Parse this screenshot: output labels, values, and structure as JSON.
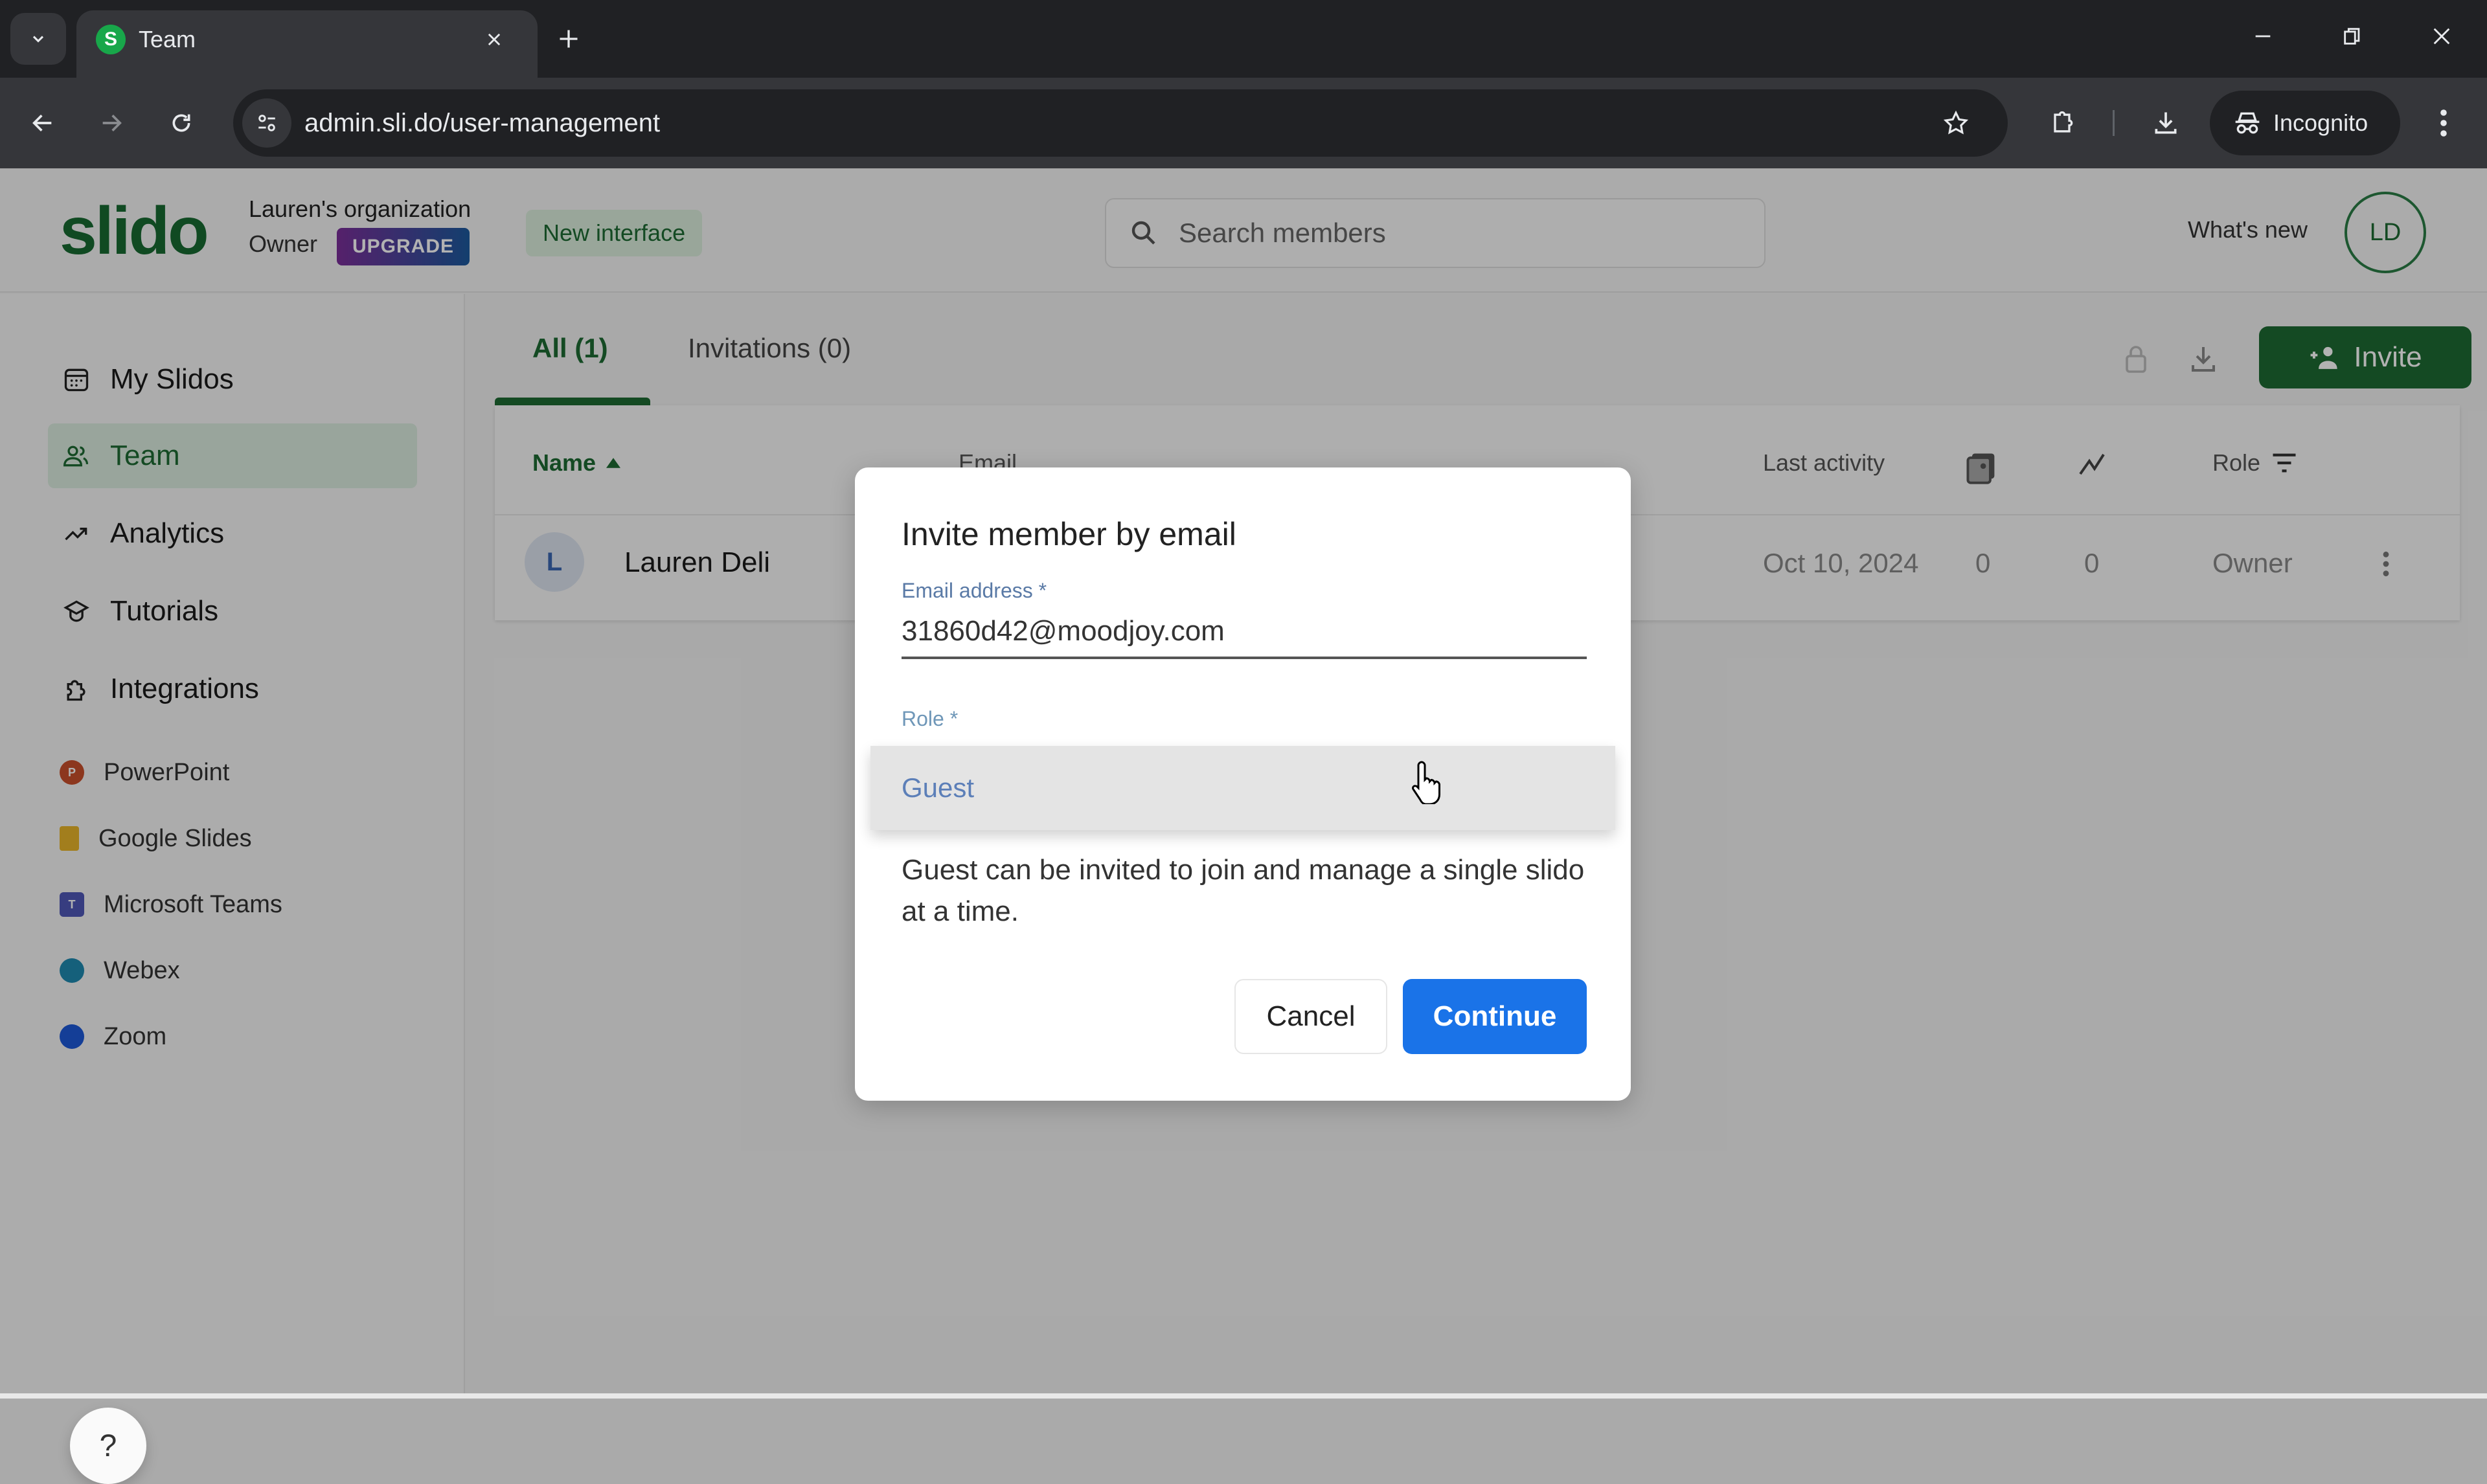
{
  "browser": {
    "tab_title": "Team",
    "tab_favicon_letter": "S",
    "url": "admin.sli.do/user-management",
    "incognito_label": "Incognito",
    "icons": {
      "tab_search": "chevron-down-icon",
      "close_tab": "close-icon",
      "new_tab": "plus-icon",
      "back": "arrow-left-icon",
      "forward": "arrow-right-icon",
      "reload": "reload-icon",
      "site_info": "tune-icon",
      "bookmark": "star-icon",
      "extensions": "puzzle-icon",
      "downloads": "download-icon",
      "incognito": "incognito-icon",
      "menu": "kebab-menu-icon"
    }
  },
  "header": {
    "logo": "slido",
    "org_name": "Lauren's organization",
    "org_role": "Owner",
    "upgrade_label": "UPGRADE",
    "new_interface_label": "New interface",
    "search_placeholder": "Search members",
    "whats_new_label": "What's new",
    "avatar_initials": "LD"
  },
  "sidebar": {
    "items": [
      {
        "label": "My Slidos",
        "icon": "calendar-icon",
        "active": false
      },
      {
        "label": "Team",
        "icon": "people-icon",
        "active": true
      },
      {
        "label": "Analytics",
        "icon": "trend-icon",
        "active": false
      },
      {
        "label": "Tutorials",
        "icon": "graduation-cap-icon",
        "active": false
      },
      {
        "label": "Integrations",
        "icon": "puzzle-icon",
        "active": false
      }
    ],
    "integrations": [
      {
        "label": "PowerPoint",
        "color": "#c9502c"
      },
      {
        "label": "Google Slides",
        "color": "#e9b52a"
      },
      {
        "label": "Microsoft Teams",
        "color": "#4f58b8"
      },
      {
        "label": "Webex",
        "color": "#1f8ab0"
      },
      {
        "label": "Zoom",
        "color": "#1e5ad8"
      }
    ],
    "help_label": "?"
  },
  "main": {
    "tabs": [
      {
        "label": "All (1)",
        "active": true
      },
      {
        "label": "Invitations (0)",
        "active": false
      }
    ],
    "invite_label": "Invite",
    "table": {
      "columns": [
        "Name",
        "Email",
        "Last activity",
        "",
        "",
        "Role"
      ],
      "rows": [
        {
          "initial": "L",
          "name": "Lauren Deli",
          "email": "",
          "last_activity": "Oct 10, 2024",
          "slidos": "0",
          "participants": "0",
          "role": "Owner"
        }
      ]
    }
  },
  "modal": {
    "title": "Invite member by email",
    "email_label": "Email address *",
    "email_value": "31860d42@moodjoy.com",
    "role_label": "Role *",
    "role_value": "Guest",
    "role_description": "Guest can be invited to join and manage a single slido at a time.",
    "cancel_label": "Cancel",
    "continue_label": "Continue"
  },
  "colors": {
    "brand_green": "#1e6b33",
    "primary_blue": "#1a73e8",
    "upgrade_gradient_start": "#7b2f9a",
    "upgrade_gradient_end": "#1c5a9e"
  }
}
